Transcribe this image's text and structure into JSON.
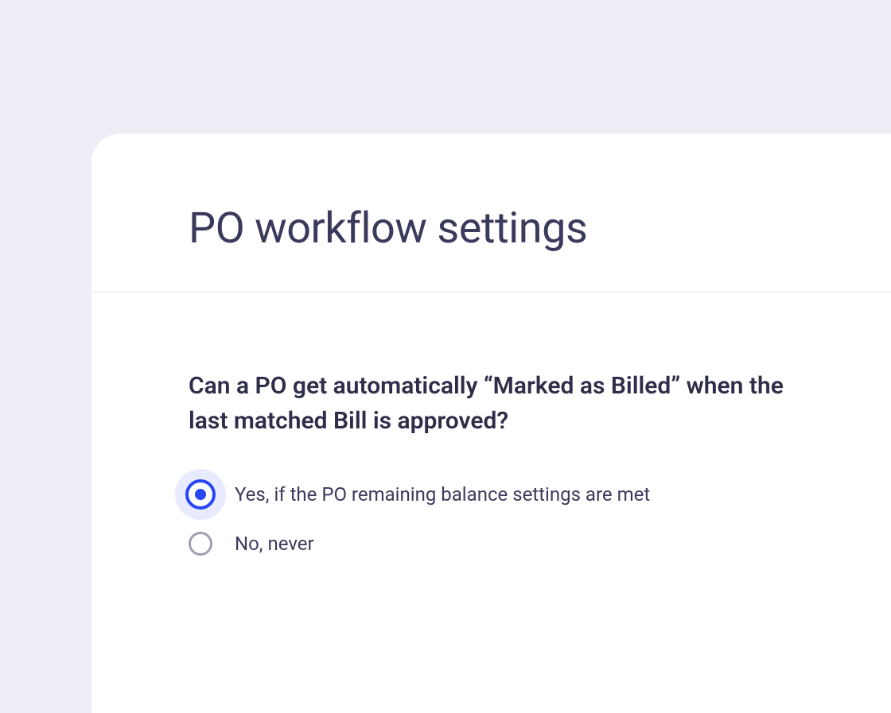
{
  "panel": {
    "title": "PO workflow settings"
  },
  "form": {
    "question": "Can a PO get automatically “Marked as Billed” when the last matched Bill is approved?",
    "options": [
      {
        "label": "Yes, if the PO remaining balance settings are met",
        "selected": true
      },
      {
        "label": "No, never",
        "selected": false
      }
    ]
  }
}
